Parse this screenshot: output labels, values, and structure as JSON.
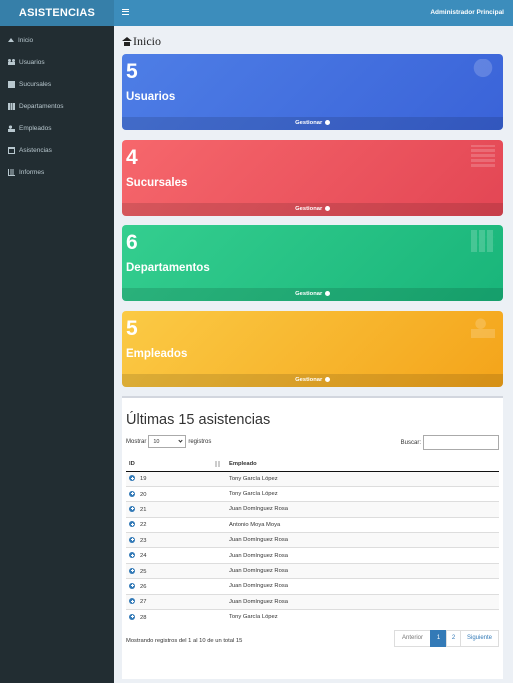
{
  "brand": "ASISTENCIAS",
  "topbar": {
    "user": "Administrador Principal"
  },
  "sidebar": {
    "items": [
      {
        "label": "Inicio",
        "icon": "home-icon"
      },
      {
        "label": "Usuarios",
        "icon": "users-icon"
      },
      {
        "label": "Sucursales",
        "icon": "building-icon"
      },
      {
        "label": "Departamentos",
        "icon": "grid-icon"
      },
      {
        "label": "Empleados",
        "icon": "employee-icon"
      },
      {
        "label": "Asistencias",
        "icon": "calendar-icon"
      },
      {
        "label": "Informes",
        "icon": "bar-chart-icon"
      }
    ]
  },
  "page": {
    "title": "Inicio"
  },
  "cards": [
    {
      "value": "5",
      "label": "Usuarios",
      "link": "Gestionar",
      "color": "#4e7ee6"
    },
    {
      "value": "4",
      "label": "Sucursales",
      "link": "Gestionar",
      "color": "#f6676c"
    },
    {
      "value": "6",
      "label": "Departamentos",
      "link": "Gestionar",
      "color": "#34ce8f"
    },
    {
      "value": "5",
      "label": "Empleados",
      "link": "Gestionar",
      "color": "#fbca45"
    }
  ],
  "table_panel": {
    "title": "Últimas 15 asistencias",
    "show_label": "Mostrar",
    "page_length": "10",
    "records_label": "registros",
    "search_label": "Buscar:",
    "columns": [
      "ID",
      "Empleado"
    ],
    "rows": [
      {
        "id": "19",
        "empleado": "Tony García López"
      },
      {
        "id": "20",
        "empleado": "Tony García López"
      },
      {
        "id": "21",
        "empleado": "Juan Domínguez Rosa"
      },
      {
        "id": "22",
        "empleado": "Antonio Moya Moya"
      },
      {
        "id": "23",
        "empleado": "Juan Domínguez Rosa"
      },
      {
        "id": "24",
        "empleado": "Juan Domínguez Rosa"
      },
      {
        "id": "25",
        "empleado": "Juan Domínguez Rosa"
      },
      {
        "id": "26",
        "empleado": "Juan Domínguez Rosa"
      },
      {
        "id": "27",
        "empleado": "Juan Domínguez Rosa"
      },
      {
        "id": "28",
        "empleado": "Tony García López"
      }
    ],
    "info": "Mostrando registros del 1 al 10 de un total 15",
    "pagination": {
      "prev": "Anterior",
      "pages": [
        "1",
        "2"
      ],
      "next": "Siguiente"
    }
  }
}
